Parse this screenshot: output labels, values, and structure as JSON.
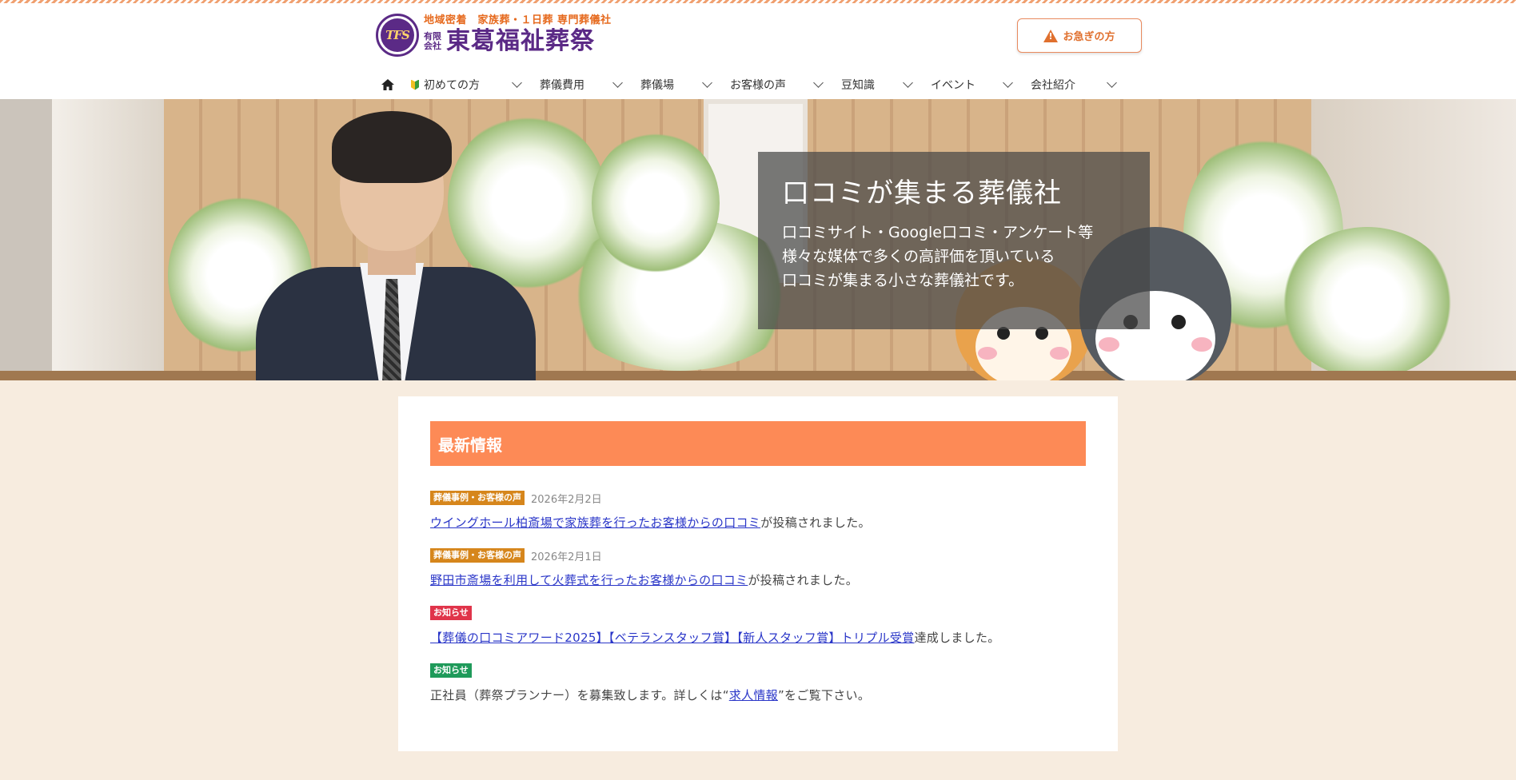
{
  "header": {
    "tagline": "地域密着　家族葬・１日葬 専門葬儀社",
    "emblem_text": "TFS",
    "company_kind_1": "有限",
    "company_kind_2": "会社",
    "company_name": "東葛福祉葬祭",
    "urgent_label": "お急ぎの方"
  },
  "nav": {
    "items": [
      {
        "label": "初めての方"
      },
      {
        "label": "葬儀費用"
      },
      {
        "label": "葬儀場"
      },
      {
        "label": "お客様の声"
      },
      {
        "label": "豆知識"
      },
      {
        "label": "イベント"
      },
      {
        "label": "会社紹介"
      }
    ]
  },
  "hero": {
    "title": "口コミが集まる葬儀社",
    "body": "口コミサイト・Google口コミ・アンケート等\n様々な媒体で多くの高評価を頂いている\n口コミが集まる小さな葬儀社です。"
  },
  "news": {
    "heading": "最新情報",
    "items": [
      {
        "category": "葬儀事例・お客様の声",
        "category_color": "#d6861c",
        "date": "2026年2月2日",
        "link": "ウイングホール柏斎場で家族葬を行ったお客様からの口コミ",
        "suffix": "が投稿されました。"
      },
      {
        "category": "葬儀事例・お客様の声",
        "category_color": "#d6861c",
        "date": "2026年2月1日",
        "link": "野田市斎場を利用して火葬式を行ったお客様からの口コミ",
        "suffix": "が投稿されました。"
      },
      {
        "category": "お知らせ",
        "category_color": "#e0344a",
        "date": "",
        "link": "【葬儀の口コミアワード2025】【ベテランスタッフ賞】【新人スタッフ賞】トリプル受賞",
        "suffix": "達成しました。"
      },
      {
        "category": "お知らせ",
        "category_color": "#1f9a5a",
        "date": "",
        "prefix": "正社員（葬祭プランナー）を募集致します。詳しくは“",
        "link": "求人情報",
        "suffix": "”をご覧下さい。"
      }
    ]
  }
}
